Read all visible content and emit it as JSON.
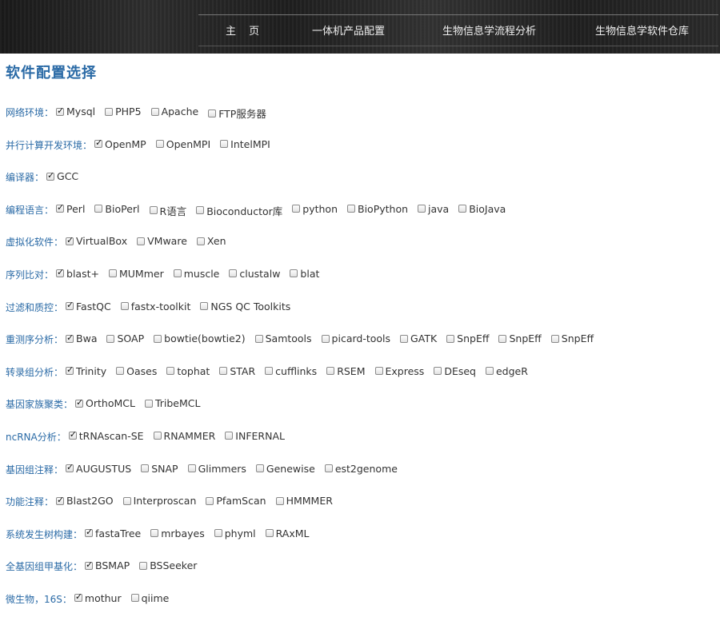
{
  "nav": {
    "items": [
      "主 页",
      "一体机产品配置",
      "生物信息学流程分析",
      "生物信息学软件仓库"
    ]
  },
  "page_title": "软件配置选择",
  "sections": [
    {
      "label": "网络环境：",
      "options": [
        {
          "label": "Mysql",
          "checked": true
        },
        {
          "label": "PHP5",
          "checked": false
        },
        {
          "label": "Apache",
          "checked": false
        },
        {
          "label": "FTP服务器",
          "checked": false
        }
      ]
    },
    {
      "label": "并行计算开发环境：",
      "options": [
        {
          "label": "OpenMP",
          "checked": true
        },
        {
          "label": "OpenMPI",
          "checked": false
        },
        {
          "label": "IntelMPI",
          "checked": false
        }
      ]
    },
    {
      "label": "编译器：",
      "options": [
        {
          "label": "GCC",
          "checked": true
        }
      ]
    },
    {
      "label": "编程语言：",
      "options": [
        {
          "label": "Perl",
          "checked": true
        },
        {
          "label": "BioPerl",
          "checked": false
        },
        {
          "label": "R语言",
          "checked": false
        },
        {
          "label": "Bioconductor库",
          "checked": false
        },
        {
          "label": "python",
          "checked": false
        },
        {
          "label": "BioPython",
          "checked": false
        },
        {
          "label": "java",
          "checked": false
        },
        {
          "label": "BioJava",
          "checked": false
        }
      ]
    },
    {
      "label": "虚拟化软件：",
      "options": [
        {
          "label": "VirtualBox",
          "checked": true
        },
        {
          "label": "VMware",
          "checked": false
        },
        {
          "label": "Xen",
          "checked": false
        }
      ]
    },
    {
      "label": "序列比对：",
      "options": [
        {
          "label": "blast+",
          "checked": true
        },
        {
          "label": "MUMmer",
          "checked": false
        },
        {
          "label": "muscle",
          "checked": false
        },
        {
          "label": "clustalw",
          "checked": false
        },
        {
          "label": "blat",
          "checked": false
        }
      ]
    },
    {
      "label": "过滤和质控：",
      "options": [
        {
          "label": "FastQC",
          "checked": true
        },
        {
          "label": "fastx-toolkit",
          "checked": false
        },
        {
          "label": "NGS QC Toolkits",
          "checked": false
        }
      ]
    },
    {
      "label": "重测序分析：",
      "options": [
        {
          "label": "Bwa",
          "checked": true
        },
        {
          "label": "SOAP",
          "checked": false
        },
        {
          "label": "bowtie(bowtie2)",
          "checked": false
        },
        {
          "label": "Samtools",
          "checked": false
        },
        {
          "label": "picard-tools",
          "checked": false
        },
        {
          "label": "GATK",
          "checked": false
        },
        {
          "label": "SnpEff",
          "checked": false
        },
        {
          "label": "SnpEff",
          "checked": false
        },
        {
          "label": "SnpEff",
          "checked": false
        }
      ]
    },
    {
      "label": "转录组分析：",
      "options": [
        {
          "label": "Trinity",
          "checked": true
        },
        {
          "label": "Oases",
          "checked": false
        },
        {
          "label": "tophat",
          "checked": false
        },
        {
          "label": "STAR",
          "checked": false
        },
        {
          "label": "cufflinks",
          "checked": false
        },
        {
          "label": "RSEM",
          "checked": false
        },
        {
          "label": "Express",
          "checked": false
        },
        {
          "label": "DEseq",
          "checked": false
        },
        {
          "label": "edgeR",
          "checked": false
        }
      ]
    },
    {
      "label": "基因家族聚类：",
      "options": [
        {
          "label": "OrthoMCL",
          "checked": true
        },
        {
          "label": "TribeMCL",
          "checked": false
        }
      ]
    },
    {
      "label": "ncRNA分析：",
      "options": [
        {
          "label": "tRNAscan-SE",
          "checked": true
        },
        {
          "label": "RNAMMER",
          "checked": false
        },
        {
          "label": "INFERNAL",
          "checked": false
        }
      ]
    },
    {
      "label": "基因组注释：",
      "options": [
        {
          "label": "AUGUSTUS",
          "checked": true
        },
        {
          "label": "SNAP",
          "checked": false
        },
        {
          "label": "Glimmers",
          "checked": false
        },
        {
          "label": "Genewise",
          "checked": false
        },
        {
          "label": "est2genome",
          "checked": false
        }
      ]
    },
    {
      "label": "功能注释：",
      "options": [
        {
          "label": "Blast2GO",
          "checked": true
        },
        {
          "label": "Interproscan",
          "checked": false
        },
        {
          "label": "PfamScan",
          "checked": false
        },
        {
          "label": "HMMMER",
          "checked": false
        }
      ]
    },
    {
      "label": "系统发生树构建：",
      "options": [
        {
          "label": "fastaTree",
          "checked": true
        },
        {
          "label": "mrbayes",
          "checked": false
        },
        {
          "label": "phyml",
          "checked": false
        },
        {
          "label": "RAxML",
          "checked": false
        }
      ]
    },
    {
      "label": "全基因组甲基化：",
      "options": [
        {
          "label": "BSMAP",
          "checked": true
        },
        {
          "label": "BSSeeker",
          "checked": false
        }
      ]
    },
    {
      "label": "微生物，16S：",
      "options": [
        {
          "label": "mothur",
          "checked": true
        },
        {
          "label": "qiime",
          "checked": false
        }
      ]
    }
  ]
}
